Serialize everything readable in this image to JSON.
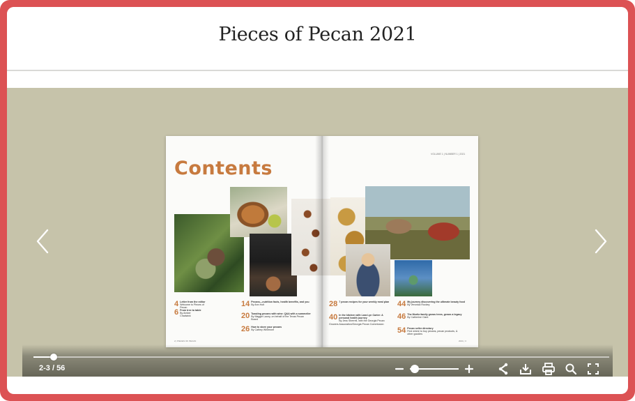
{
  "document": {
    "title": "Pieces of Pecan 2021"
  },
  "spread": {
    "heading": "Contents",
    "masthead": "VOLUME 1 | NUMBER 1 | 2021",
    "left_footer": "2 | PIECES OF PECAN",
    "right_footer": "2021 | 3",
    "toc": [
      {
        "num": "4",
        "title": "Letter from the editor",
        "sub": "Welcome to Pieces of Pecan"
      },
      {
        "num": "6",
        "title": "From tree to table",
        "sub": "By Amber Chadwick"
      },
      {
        "num": "14",
        "title": "Pecans—nutrition facts, health benefits, and you",
        "sub": "By Ann Holt"
      },
      {
        "num": "20",
        "title": "Toasting pecans with wine: Q&A with a sommelier",
        "sub": "By Maggie Lacey, on behalf of the Texas Pecan Board"
      },
      {
        "num": "26",
        "title": "How to store your pecans",
        "sub": "By Cathey Whitmore"
      },
      {
        "num": "28",
        "title": "7 pecan recipes for your weekly meal plan",
        "sub": ""
      },
      {
        "num": "40",
        "title": "In the kitchen with Lara Lyn Carter: A personal health journey",
        "sub": "By Jess Sherrell, with the Georgia Pecan Growers Association/Georgia Pecan Commission"
      },
      {
        "num": "44",
        "title": "My journey discovering the ultimate beauty food",
        "sub": "By Veronica Rockey"
      },
      {
        "num": "46",
        "title": "The Moritz family grows trees, grows a legacy",
        "sub": "By Catherine Clark"
      },
      {
        "num": "54",
        "title": "Pecan seller directory",
        "sub": "Find where to buy pecans, pecan products, & other goodies"
      }
    ]
  },
  "viewer": {
    "page_indicator": "2-3 / 56",
    "progress_fraction": 0.035,
    "zoom_fraction": 0.05,
    "zoom_minus_label": "−",
    "zoom_plus_label": "+"
  },
  "colors": {
    "frame": "#dc5254",
    "viewer_bg": "#c6c3aa",
    "accent": "#c77a3f"
  },
  "icons": [
    "chevron-left-icon",
    "chevron-right-icon",
    "share-icon",
    "download-icon",
    "print-icon",
    "search-icon",
    "fullscreen-icon"
  ]
}
